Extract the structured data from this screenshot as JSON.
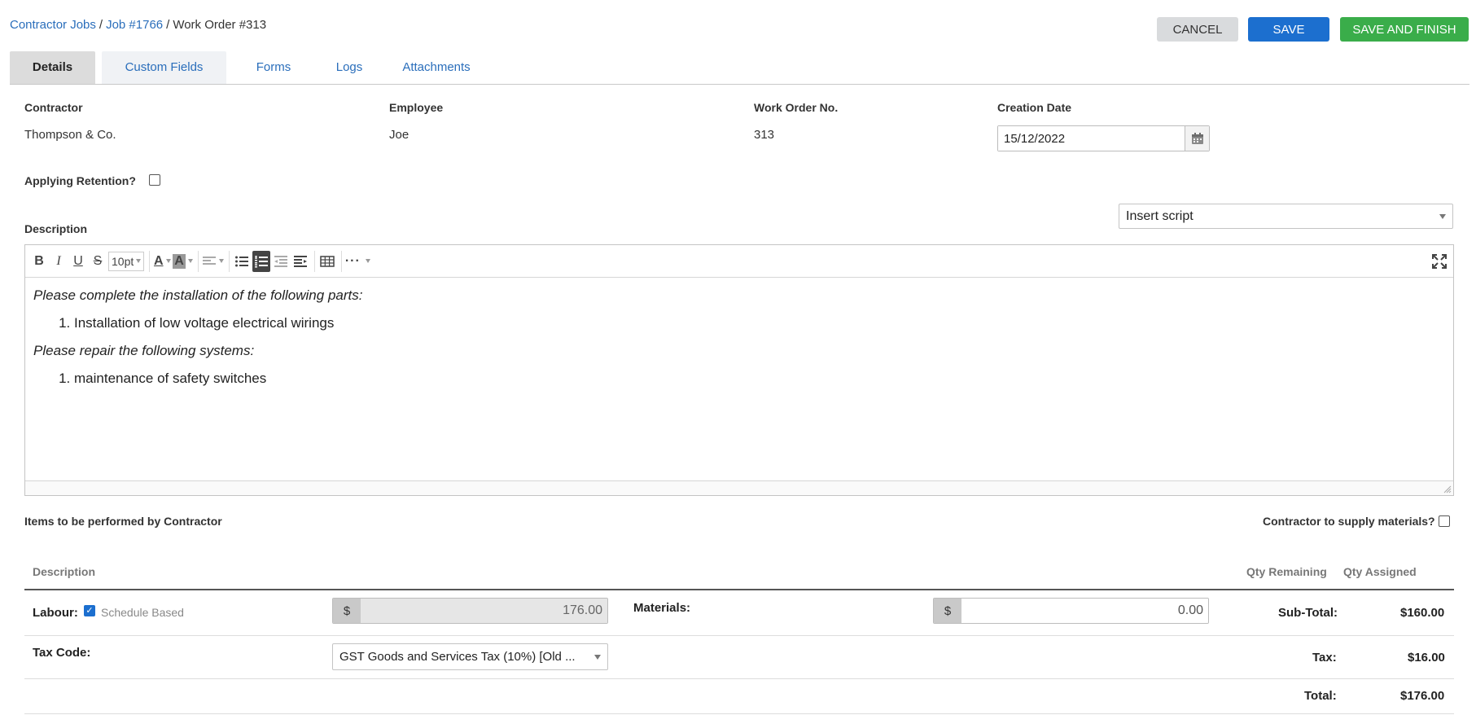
{
  "breadcrumb": {
    "items": [
      "Contractor Jobs",
      "Job #1766"
    ],
    "separator": "/",
    "current": "Work Order #313"
  },
  "actions": {
    "cancel": "CANCEL",
    "save": "SAVE",
    "save_finish": "SAVE AND FINISH"
  },
  "tabs": [
    {
      "label": "Details",
      "active": true
    },
    {
      "label": "Custom Fields"
    },
    {
      "label": "Forms"
    },
    {
      "label": "Logs"
    },
    {
      "label": "Attachments"
    }
  ],
  "details": {
    "contractor_label": "Contractor",
    "contractor_value": "Thompson & Co.",
    "employee_label": "Employee",
    "employee_value": "Joe",
    "work_order_label": "Work Order No.",
    "work_order_value": "313",
    "creation_date_label": "Creation Date",
    "creation_date_value": "15/12/2022",
    "retention_label": "Applying Retention?",
    "retention_checked": false
  },
  "description": {
    "label": "Description",
    "insert_script": "Insert script",
    "toolbar": {
      "font_size": "10pt"
    },
    "content": {
      "para1": "Please complete the installation of the following parts:",
      "list1": [
        "Installation of low voltage electrical wirings"
      ],
      "para2": "Please repair the following systems:",
      "list2": [
        "maintenance of safety switches"
      ]
    }
  },
  "items": {
    "title": "Items to be performed by Contractor",
    "supply_label": "Contractor to supply materials?",
    "supply_checked": false,
    "headers": {
      "description": "Description",
      "qty_remaining": "Qty Remaining",
      "qty_assigned": "Qty Assigned"
    },
    "labour_label": "Labour:",
    "schedule_based_label": "Schedule Based",
    "schedule_based_checked": true,
    "currency": "$",
    "labour_value": "176.00",
    "materials_label": "Materials:",
    "materials_value": "0.00",
    "tax_code_label": "Tax Code:",
    "tax_code_value": "GST Goods and Services Tax (10%) [Old ...",
    "subtotal_label": "Sub-Total:",
    "subtotal_value": "$160.00",
    "tax_label": "Tax:",
    "tax_value": "$16.00",
    "total_label": "Total:",
    "total_value": "$176.00"
  },
  "colors": {
    "link": "#2a6ebb",
    "save": "#1c6fcf",
    "save_finish": "#3aad4a",
    "cancel": "#d9dbdd"
  }
}
